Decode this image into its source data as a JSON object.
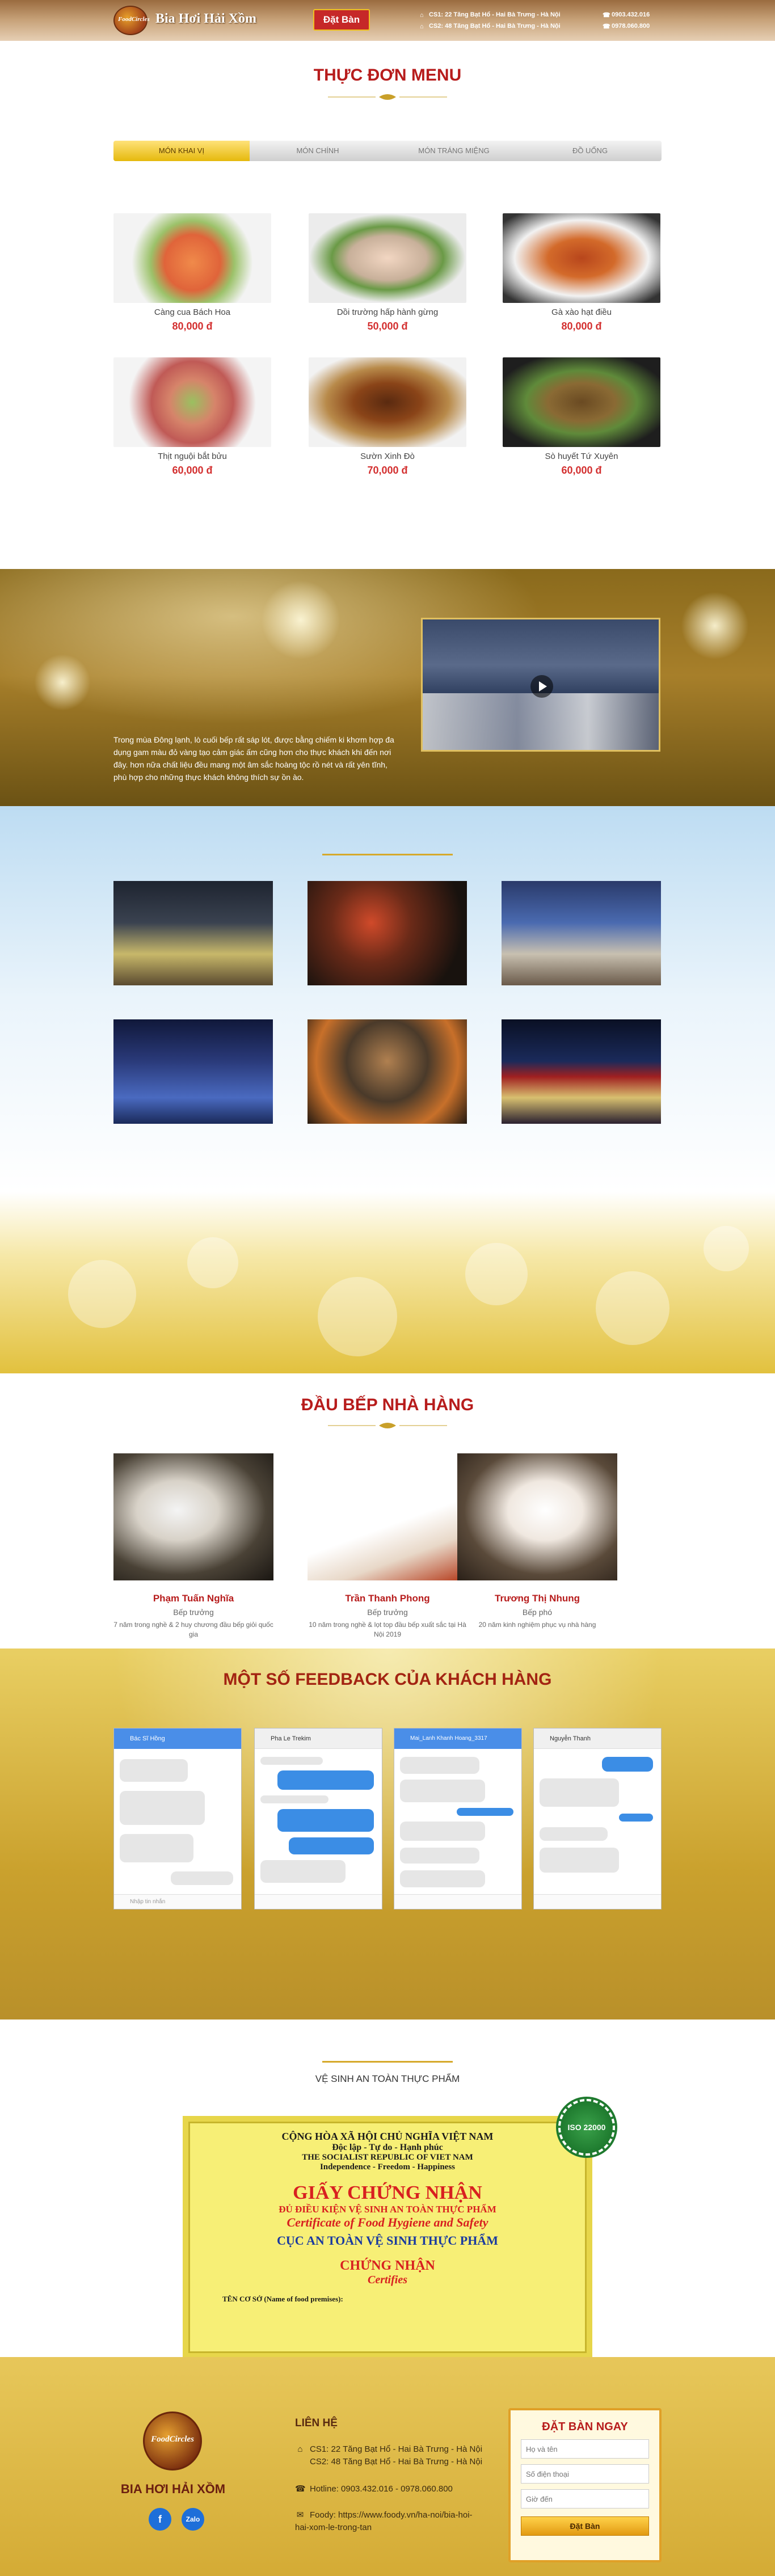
{
  "header": {
    "brand": "Bia Hơi Hải Xồm",
    "logo_text": "FoodCircles",
    "book_button": "Đặt Bàn",
    "address1": "CS1: 22 Tăng Bạt Hổ - Hai Bà Trưng - Hà Nội",
    "address2": "CS2: 48 Tăng Bạt Hổ - Hai Bà Trưng - Hà Nội",
    "phone1": "0903.432.016",
    "phone2": "0978.060.800"
  },
  "menu": {
    "title": "THỰC ĐƠN MENU",
    "tabs": [
      "MÓN KHAI VỊ",
      "MÓN CHÍNH",
      "MÓN TRÁNG MIỆNG",
      "ĐỒ UỐNG"
    ],
    "dishes": [
      {
        "name": "Càng cua Bách Hoa",
        "price": "80,000 đ"
      },
      {
        "name": "Dồi trường hấp hành gừng",
        "price": "50,000 đ"
      },
      {
        "name": "Gà xào hạt điều",
        "price": "80,000 đ"
      },
      {
        "name": "Thịt nguội bắt bửu",
        "price": "60,000 đ"
      },
      {
        "name": "Sườn Xinh Đò",
        "price": "70,000 đ"
      },
      {
        "name": "Sò huyết Tứ Xuyên",
        "price": "60,000 đ"
      }
    ]
  },
  "about": {
    "text": "Trong mùa Đông lạnh, lò cuối bếp rất sáp lót, được bằng chiếm ki khơm hợp đa dụng gam màu đỏ vàng tạo cảm giác ấm cũng hơn cho thực khách khi đến nơi đây. hơn nữa chất liệu đều mang một âm sắc hoàng tộc rồ nét và rất yên tĩnh, phù hợp cho những thực khách không thích sự ồn ào."
  },
  "chefs": {
    "title": "ĐẦU BẾP NHÀ HÀNG",
    "items": [
      {
        "name": "Phạm Tuấn Nghĩa",
        "role": "Bếp trưởng",
        "desc": "7 năm trong nghề & 2 huy chương đầu bếp giỏi quốc gia"
      },
      {
        "name": "Trần Thanh Phong",
        "role": "Bếp trưởng",
        "desc": "10 năm trong nghề & lọt top đầu bếp xuất sắc tại Hà Nội 2019"
      },
      {
        "name": "Trương Thị Nhung",
        "role": "Bếp phó",
        "desc": "20 năm kinh nghiệm phục vụ nhà hàng"
      }
    ]
  },
  "feedback": {
    "title": "MỘT SỐ FEEDBACK CỦA KHÁCH HÀNG",
    "chats": [
      {
        "name": "Bác Sĩ Hồng",
        "input": "Nhập tin nhắn"
      },
      {
        "name": "Pha Le Trekim",
        "input": ""
      },
      {
        "name": "Mai_Lanh Khanh Hoang_3317",
        "input": ""
      },
      {
        "name": "Nguyễn Thanh",
        "input": ""
      }
    ]
  },
  "certificate": {
    "heading": "VỆ SINH AN TOÀN THỰC PHẨM",
    "seal": "ISO 22000",
    "l1": "CỘNG HÒA XÃ HỘI CHỦ NGHĨA VIỆT NAM",
    "l2": "Độc lập - Tự do - Hạnh phúc",
    "l3": "THE SOCIALIST REPUBLIC OF VIET NAM",
    "l4": "Independence - Freedom - Happiness",
    "l5": "GIẤY CHỨNG NHẬN",
    "l6": "ĐỦ ĐIỀU KIỆN VỆ SINH AN TOÀN THỰC PHẨM",
    "l7": "Certificate of Food Hygiene and Safety",
    "l8": "CỤC AN TOÀN VỆ SINH THỰC PHẨM",
    "l9": "CHỨNG NHẬN",
    "l10": "Certifies",
    "l11": "TÊN CƠ SỞ (Name of food premises):"
  },
  "footer": {
    "brand": "BIA HƠI HẢI XỒM",
    "logo_text": "FoodCircles",
    "contact_title": "LIÊN HỆ",
    "cs1": "CS1: 22 Tăng Bạt Hổ - Hai Bà Trưng - Hà Nội",
    "cs2": "CS2: 48 Tăng Bạt Hổ - Hai Bà Trưng - Hà Nội",
    "hotline": "Hotline: 0903.432.016 - 0978.060.800",
    "foody": "Foody: https://www.foody.vn/ha-noi/bia-hoi-hai-xom-le-trong-tan",
    "facebook": "f",
    "zalo": "Zalo",
    "form_title": "ĐẶT BÀN NGAY",
    "name_placeholder": "Họ và tên",
    "phone_placeholder": "Số điện thoại",
    "time_placeholder": "Giờ đến",
    "submit": "Đặt Bàn"
  }
}
